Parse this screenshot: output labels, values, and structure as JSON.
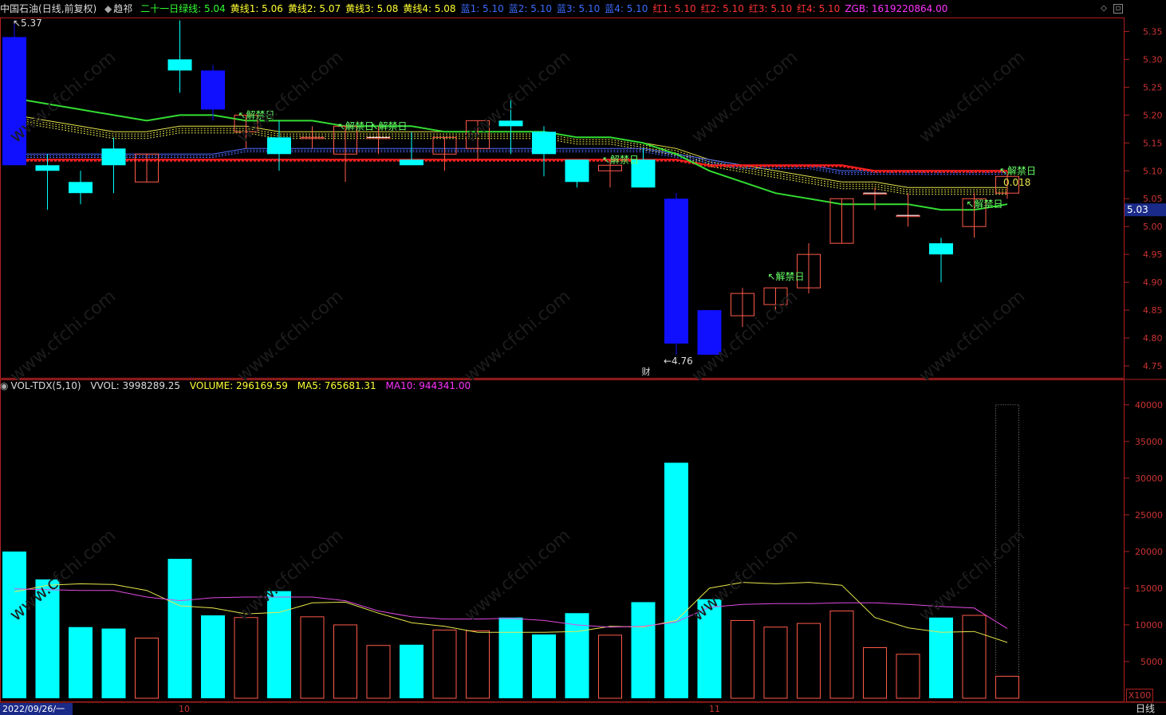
{
  "header": {
    "stock": "中国石油",
    "period": "(日线,前复权)",
    "indicator": "趋祁",
    "items": [
      {
        "label": "二十一日绿线:",
        "value": "5.04",
        "color": "#33ff33"
      },
      {
        "label": "黄线1:",
        "value": "5.06",
        "color": "#ffff33"
      },
      {
        "label": "黄线2:",
        "value": "5.07",
        "color": "#ffff33"
      },
      {
        "label": "黄线3:",
        "value": "5.08",
        "color": "#ffff33"
      },
      {
        "label": "黄线4:",
        "value": "5.08",
        "color": "#ffff33"
      },
      {
        "label": "蓝1:",
        "value": "5.10",
        "color": "#3b6cff"
      },
      {
        "label": "蓝2:",
        "value": "5.10",
        "color": "#3b6cff"
      },
      {
        "label": "蓝3:",
        "value": "5.10",
        "color": "#3b6cff"
      },
      {
        "label": "蓝4:",
        "value": "5.10",
        "color": "#3b6cff"
      },
      {
        "label": "红1:",
        "value": "5.10",
        "color": "#ff3333"
      },
      {
        "label": "红2:",
        "value": "5.10",
        "color": "#ff3333"
      },
      {
        "label": "红3:",
        "value": "5.10",
        "color": "#ff3333"
      },
      {
        "label": "红4:",
        "value": "5.10",
        "color": "#ff3333"
      },
      {
        "label": "ZGB:",
        "value": "1619220864.00",
        "color": "#ff33ff"
      }
    ]
  },
  "price_axis": {
    "ticks": [
      "5.35",
      "5.30",
      "5.25",
      "5.20",
      "5.15",
      "5.10",
      "5.05",
      "5.00",
      "4.95",
      "4.90",
      "4.85",
      "4.80",
      "4.75"
    ],
    "current_price": "5.03"
  },
  "annotations": {
    "high_label": "5.37",
    "low_label": "4.76",
    "jiejin": "解禁日",
    "cai": "财",
    "small_value": "0.018"
  },
  "volume_header": {
    "name": "VOL-TDX(5,10)",
    "vvol": "VVOL: 3998289.25",
    "volume": "VOLUME: 296169.59",
    "ma5": "MA5: 765681.31",
    "ma10": "MA10: 944341.00",
    "colors": {
      "volume": "#ffff33",
      "ma5": "#ffff33",
      "ma10": "#ff33ff"
    }
  },
  "volume_axis": {
    "ticks": [
      "40000",
      "35000",
      "30000",
      "25000",
      "20000",
      "15000",
      "10000",
      "5000"
    ],
    "unit": "X100"
  },
  "date_axis": {
    "start": "2022/09/26/一",
    "months": [
      "10",
      "11"
    ],
    "period_label": "日线"
  },
  "colors": {
    "up": "#ff5a4a",
    "down": "#00ffff",
    "big_down": "#1010ff",
    "green_line": "#33dd33",
    "yellow_line": "#e6e64d",
    "red_line": "#ff2020",
    "blue_line": "#4f6bff",
    "axis": "#b02020"
  },
  "chart_data": {
    "type": "candlestick",
    "price_range": [
      4.74,
      5.37
    ],
    "candles": [
      {
        "o": 5.34,
        "h": 5.37,
        "l": 5.11,
        "c": 5.11,
        "vol": 20000
      },
      {
        "o": 5.11,
        "h": 5.13,
        "l": 5.03,
        "c": 5.1,
        "vol": 16200
      },
      {
        "o": 5.08,
        "h": 5.1,
        "l": 5.04,
        "c": 5.06,
        "vol": 9700
      },
      {
        "o": 5.14,
        "h": 5.16,
        "l": 5.06,
        "c": 5.11,
        "vol": 9500
      },
      {
        "o": 5.08,
        "h": 5.13,
        "l": 5.08,
        "c": 5.13,
        "vol": 8200
      },
      {
        "o": 5.3,
        "h": 5.37,
        "l": 5.24,
        "c": 5.28,
        "vol": 19000
      },
      {
        "o": 5.28,
        "h": 5.29,
        "l": 5.19,
        "c": 5.21,
        "vol": 11300
      },
      {
        "o": 5.17,
        "h": 5.2,
        "l": 5.14,
        "c": 5.2,
        "vol": 11000
      },
      {
        "o": 5.16,
        "h": 5.19,
        "l": 5.1,
        "c": 5.13,
        "vol": 14600
      },
      {
        "o": 5.16,
        "h": 5.18,
        "l": 5.14,
        "c": 5.16,
        "vol": 11100
      },
      {
        "o": 5.13,
        "h": 5.18,
        "l": 5.08,
        "c": 5.18,
        "vol": 10000
      },
      {
        "o": 5.16,
        "h": 5.18,
        "l": 5.13,
        "c": 5.16,
        "vol": 7200
      },
      {
        "o": 5.12,
        "h": 5.17,
        "l": 5.11,
        "c": 5.11,
        "vol": 7300
      },
      {
        "o": 5.13,
        "h": 5.16,
        "l": 5.1,
        "c": 5.16,
        "vol": 9300
      },
      {
        "o": 5.14,
        "h": 5.19,
        "l": 5.12,
        "c": 5.19,
        "vol": 9200
      },
      {
        "o": 5.19,
        "h": 5.23,
        "l": 5.13,
        "c": 5.18,
        "vol": 11000
      },
      {
        "o": 5.17,
        "h": 5.18,
        "l": 5.09,
        "c": 5.13,
        "vol": 8700
      },
      {
        "o": 5.12,
        "h": 5.12,
        "l": 5.07,
        "c": 5.08,
        "vol": 11600
      },
      {
        "o": 5.1,
        "h": 5.12,
        "l": 5.07,
        "c": 5.11,
        "vol": 8600
      },
      {
        "o": 5.12,
        "h": 5.14,
        "l": 5.07,
        "c": 5.07,
        "vol": 13100
      },
      {
        "o": 5.05,
        "h": 5.06,
        "l": 4.77,
        "c": 4.79,
        "vol": 32100
      },
      {
        "o": 4.85,
        "h": 4.85,
        "l": 4.77,
        "c": 4.77,
        "vol": 13500
      },
      {
        "o": 4.84,
        "h": 4.89,
        "l": 4.82,
        "c": 4.88,
        "vol": 10600
      },
      {
        "o": 4.86,
        "h": 4.89,
        "l": 4.85,
        "c": 4.89,
        "vol": 9700
      },
      {
        "o": 4.89,
        "h": 4.97,
        "l": 4.88,
        "c": 4.95,
        "vol": 10200
      },
      {
        "o": 4.97,
        "h": 5.05,
        "l": 4.97,
        "c": 5.05,
        "vol": 11900
      },
      {
        "o": 5.06,
        "h": 5.07,
        "l": 5.03,
        "c": 5.06,
        "vol": 6900
      },
      {
        "o": 5.02,
        "h": 5.06,
        "l": 5.0,
        "c": 5.02,
        "vol": 6000
      },
      {
        "o": 4.97,
        "h": 4.98,
        "l": 4.9,
        "c": 4.95,
        "vol": 11000
      },
      {
        "o": 5.0,
        "h": 5.06,
        "l": 4.98,
        "c": 5.05,
        "vol": 11300
      },
      {
        "o": 5.06,
        "h": 5.1,
        "l": 5.05,
        "c": 5.09,
        "vol": 3000
      }
    ],
    "lines": {
      "green": [
        5.23,
        5.22,
        5.21,
        5.2,
        5.19,
        5.2,
        5.2,
        5.19,
        5.19,
        5.19,
        5.18,
        5.18,
        5.18,
        5.17,
        5.17,
        5.17,
        5.17,
        5.16,
        5.16,
        5.15,
        5.13,
        5.1,
        5.08,
        5.06,
        5.05,
        5.04,
        5.04,
        5.04,
        5.03,
        5.03,
        5.04
      ],
      "yellow": [
        5.2,
        5.19,
        5.18,
        5.17,
        5.17,
        5.18,
        5.18,
        5.18,
        5.17,
        5.17,
        5.17,
        5.17,
        5.17,
        5.17,
        5.17,
        5.17,
        5.17,
        5.16,
        5.16,
        5.15,
        5.14,
        5.12,
        5.11,
        5.1,
        5.09,
        5.08,
        5.08,
        5.07,
        5.07,
        5.07,
        5.07
      ],
      "blue": [
        5.13,
        5.13,
        5.13,
        5.13,
        5.13,
        5.13,
        5.13,
        5.14,
        5.14,
        5.14,
        5.14,
        5.14,
        5.14,
        5.14,
        5.14,
        5.14,
        5.14,
        5.14,
        5.14,
        5.14,
        5.13,
        5.12,
        5.11,
        5.11,
        5.11,
        5.1,
        5.1,
        5.1,
        5.1,
        5.1,
        5.1
      ],
      "red": [
        5.12,
        5.12,
        5.12,
        5.12,
        5.12,
        5.12,
        5.12,
        5.12,
        5.12,
        5.12,
        5.12,
        5.12,
        5.12,
        5.12,
        5.12,
        5.12,
        5.12,
        5.12,
        5.12,
        5.12,
        5.12,
        5.11,
        5.11,
        5.11,
        5.11,
        5.11,
        5.1,
        5.1,
        5.1,
        5.1,
        5.1
      ],
      "ma5_vol": [
        14500,
        15400,
        15600,
        15500,
        14700,
        12600,
        12300,
        11500,
        11700,
        13000,
        13100,
        11600,
        10300,
        9800,
        9000,
        9000,
        9000,
        9100,
        9800,
        9700,
        10600,
        15000,
        15800,
        15600,
        15800,
        15400,
        11000,
        9600,
        9000,
        9100,
        7600
      ],
      "ma10_vol": [
        14900,
        14800,
        14700,
        14700,
        13800,
        13300,
        13700,
        13800,
        13800,
        13800,
        13300,
        11900,
        11100,
        10800,
        10800,
        10900,
        10600,
        10000,
        9700,
        9800,
        10400,
        12400,
        12800,
        12900,
        12900,
        13000,
        13000,
        12800,
        12500,
        12300,
        9500
      ]
    },
    "jiejin_marks": [
      7,
      10,
      11,
      18,
      23,
      29,
      30
    ]
  }
}
